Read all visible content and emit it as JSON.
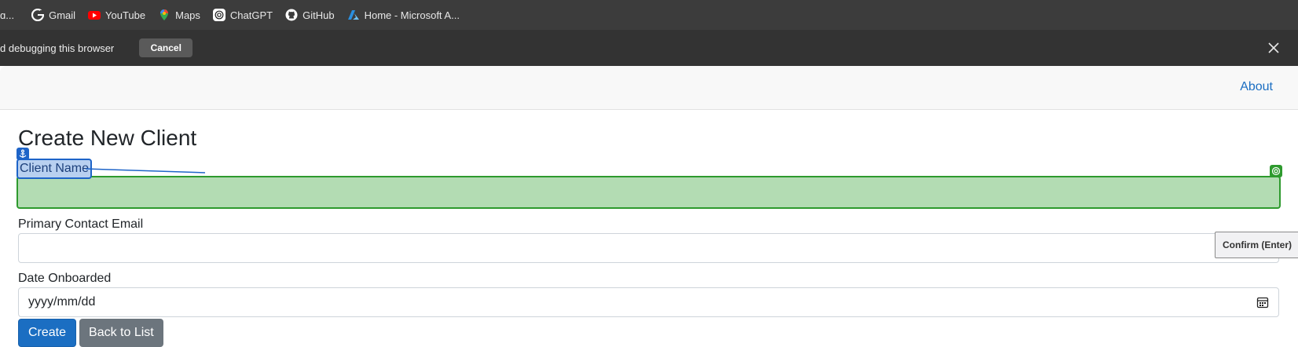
{
  "bookmarks": {
    "truncated_left": "ɑ...",
    "items": [
      {
        "label": "Gmail",
        "icon": "google-icon"
      },
      {
        "label": "YouTube",
        "icon": "youtube-icon"
      },
      {
        "label": "Maps",
        "icon": "maps-icon"
      },
      {
        "label": "ChatGPT",
        "icon": "chatgpt-icon"
      },
      {
        "label": "GitHub",
        "icon": "github-icon"
      },
      {
        "label": "Home - Microsoft A...",
        "icon": "azure-icon"
      }
    ]
  },
  "infobar": {
    "text": "d debugging this browser",
    "cancel_label": "Cancel"
  },
  "navbar": {
    "about_label": "About"
  },
  "page": {
    "title": "Create New Client"
  },
  "form": {
    "client_name_label": "Client Name",
    "client_name_value": "",
    "email_label": "Primary Contact Email",
    "email_value": "",
    "date_label": "Date Onboarded",
    "date_placeholder": "yyyy/mm/dd",
    "confirm_label": "Confirm (Enter)",
    "create_label": "Create",
    "back_label": "Back to List"
  },
  "colors": {
    "primary": "#1b6ec2",
    "secondary": "#6c757d",
    "highlight_green": "#b3dcb3",
    "highlight_blue": "#b8d0f0"
  }
}
